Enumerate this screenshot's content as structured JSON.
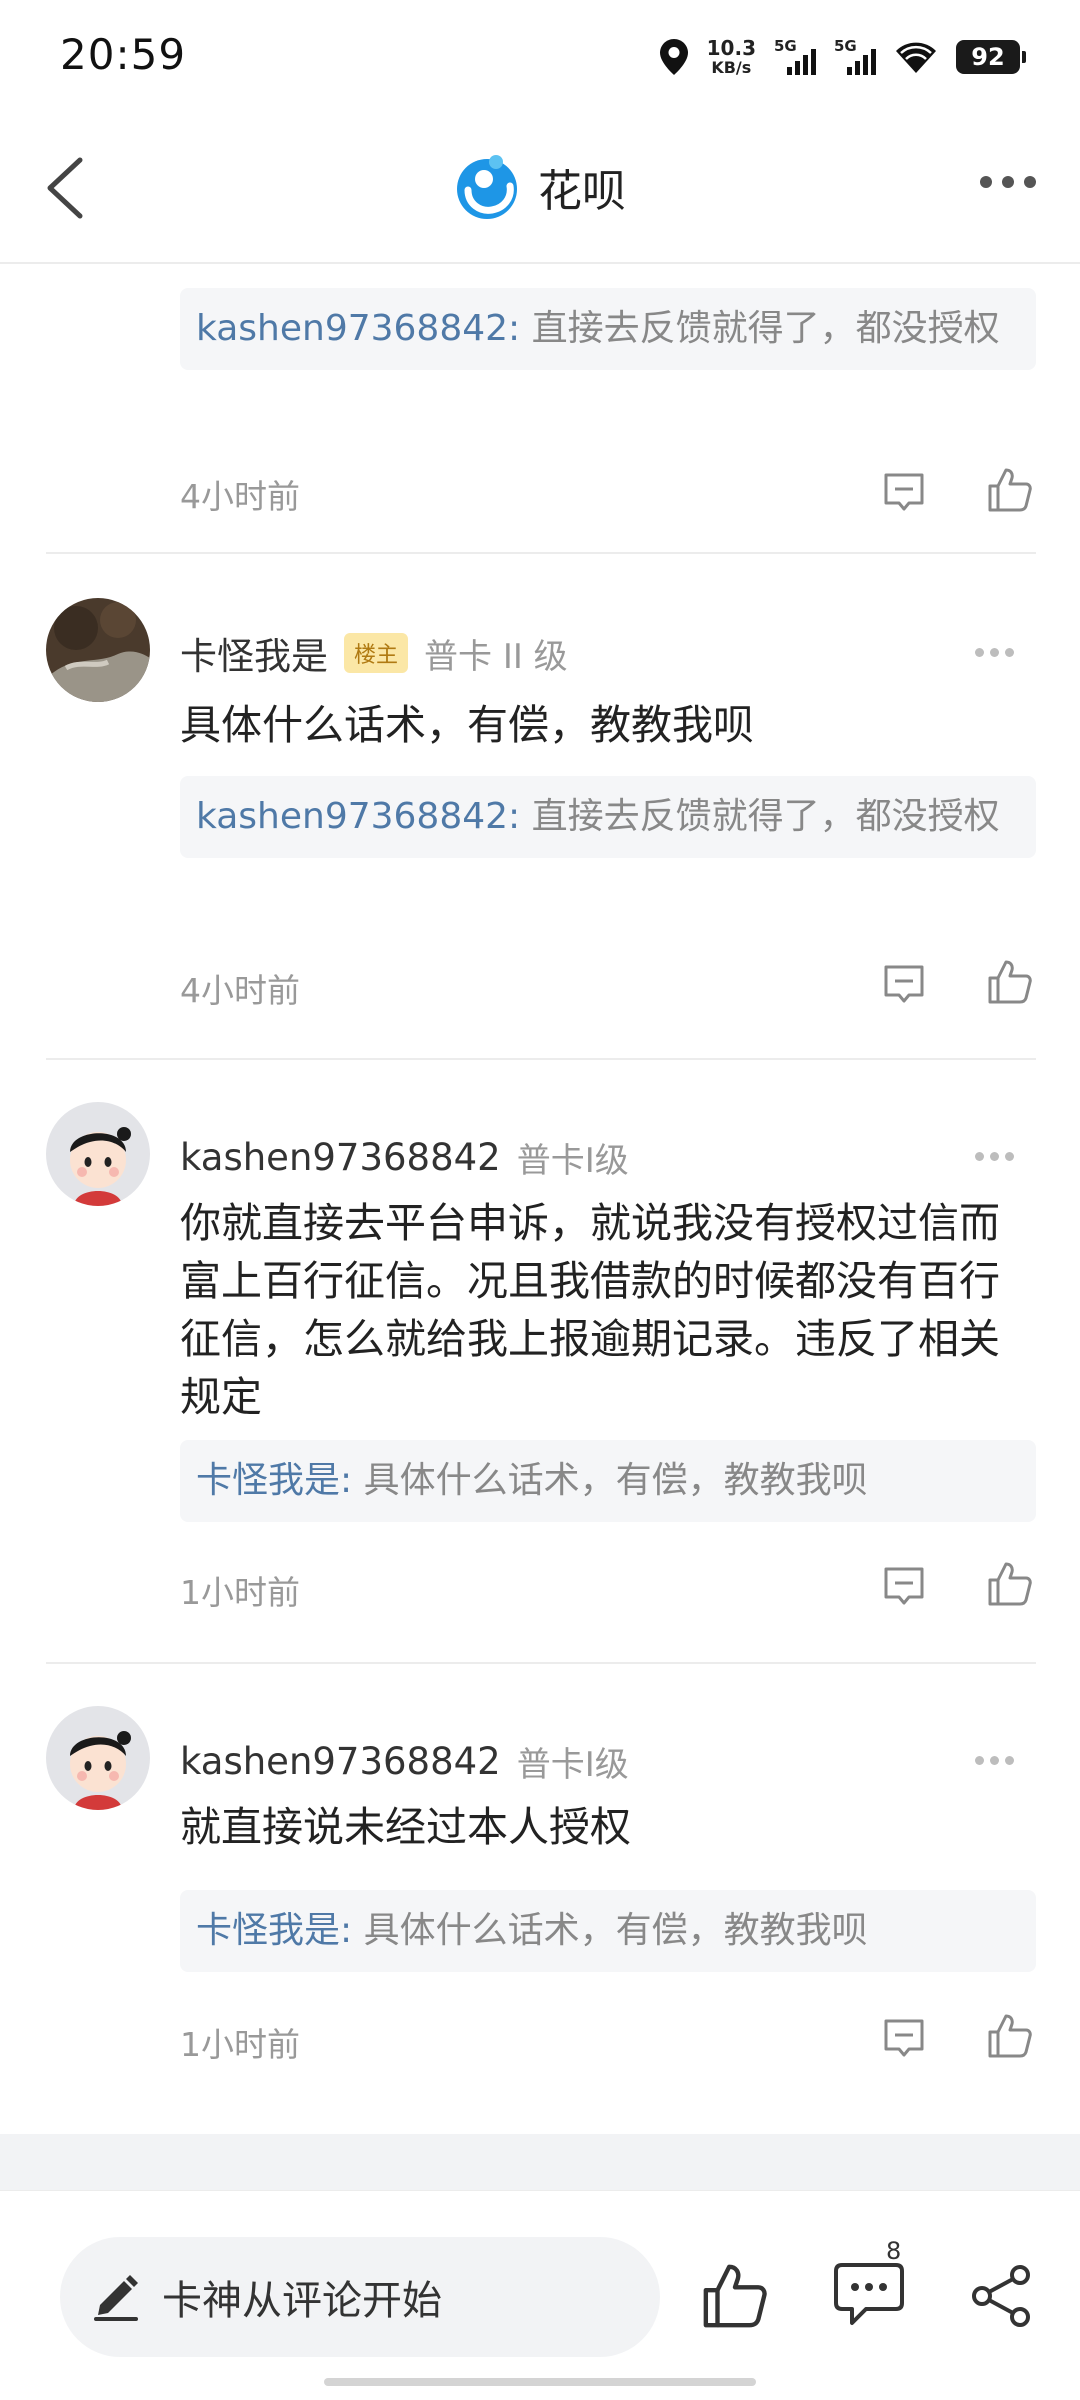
{
  "status_bar": {
    "time": "20:59",
    "net_speed_value": "10.3",
    "net_speed_unit": "KB/s",
    "sim1_label": "5G",
    "sim2_label": "5G",
    "battery": "92"
  },
  "nav": {
    "title": "花呗",
    "logo_icon": "huabei-logo-icon",
    "back_icon": "chevron-left-icon",
    "more_icon": "more-horizontal-icon"
  },
  "comments": [
    {
      "quote": {
        "user": "kashen97368842:",
        "text": " 直接去反馈就得了，都没授权"
      },
      "time": "4小时前"
    },
    {
      "username": "卡怪我是",
      "badge": "楼主",
      "level": "普卡 II 级",
      "text": "具体什么话术，有偿，教教我呗",
      "quote": {
        "user": "kashen97368842:",
        "text": " 直接去反馈就得了，都没授权"
      },
      "time": "4小时前"
    },
    {
      "username": "kashen97368842",
      "level": "普卡I级",
      "text": "你就直接去平台申诉，就说我没有授权过信而富上百行征信。况且我借款的时候都没有百行征信，怎么就给我上报逾期记录。违反了相关规定",
      "quote": {
        "user": "卡怪我是:",
        "text": " 具体什么话术，有偿，教教我呗"
      },
      "time": "1小时前"
    },
    {
      "username": "kashen97368842",
      "level": "普卡I级",
      "text": "就直接说未经过本人授权",
      "quote": {
        "user": "卡怪我是:",
        "text": " 具体什么话术，有偿，教教我呗"
      },
      "time": "1小时前"
    }
  ],
  "bottom_bar": {
    "input_placeholder": "卡神从评论开始",
    "comment_count": "8"
  },
  "colors": {
    "link_blue": "#4f79a7",
    "badge_bg": "#fbe7a6",
    "quote_bg": "#f5f6f8",
    "huabei_blue": "#1e96e6"
  }
}
